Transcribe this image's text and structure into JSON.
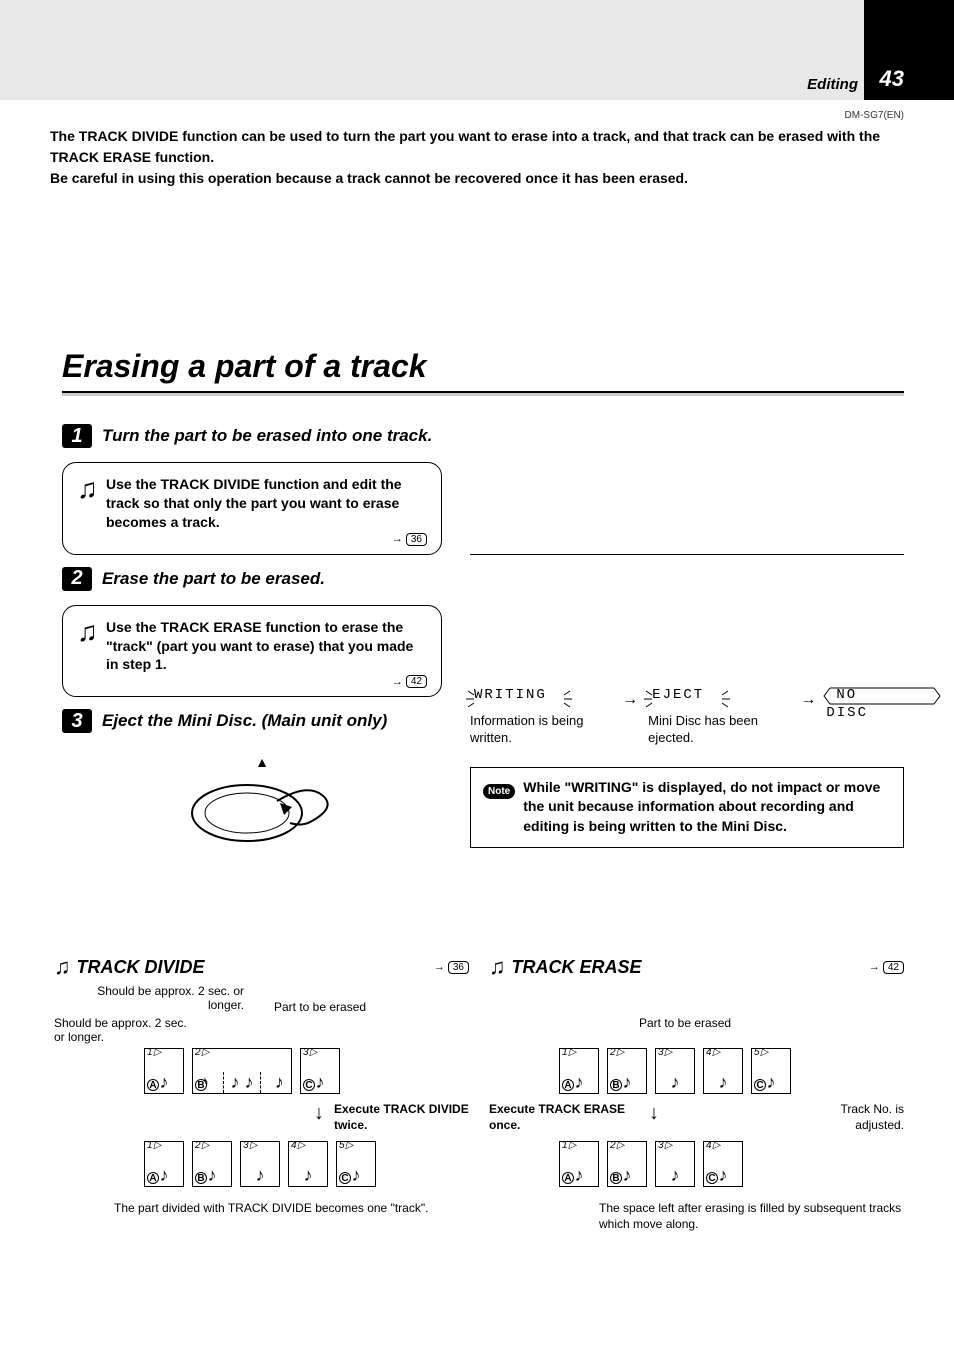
{
  "header": {
    "section": "Editing",
    "page": "43",
    "model": "DM-SG7(EN)"
  },
  "intro": "The TRACK DIVIDE function can be used to turn the part you want to erase into a track, and that track can be erased with the TRACK ERASE function.\nBe careful in using this operation because a track cannot be recovered once it has been erased.",
  "title": "Erasing a part of a track",
  "steps": [
    {
      "num": "1",
      "title": "Turn the part to be erased into one track.",
      "body": "Use the TRACK DIVIDE function and edit the track so that only the part you want to erase becomes a track.",
      "ref": "36"
    },
    {
      "num": "2",
      "title": "Erase the part to be erased.",
      "body": "Use the TRACK ERASE function to erase the \"track\" (part you want to erase) that you made in step 1.",
      "ref": "42"
    },
    {
      "num": "3",
      "title": "Eject the Mini Disc. (Main unit only)"
    }
  ],
  "displays": {
    "writing": {
      "text": "WRITING",
      "caption": "Information is being written."
    },
    "eject": {
      "text": "EJECT",
      "caption": "Mini Disc has been ejected."
    },
    "nodisc": {
      "text": "NO DISC"
    }
  },
  "note": "While \"WRITING\" is displayed, do not impact or move the unit because information about recording and editing is being written to the Mini Disc.",
  "note_label": "Note",
  "diagrams": {
    "divide": {
      "title": "TRACK DIVIDE",
      "ref": "36",
      "label_approx_top": "Should be approx. 2 sec. or longer.",
      "label_approx_left": "Should be approx. 2 sec. or longer.",
      "label_part": "Part to be erased",
      "action": "Execute TRACK DIVIDE twice.",
      "caption": "The part divided with TRACK DIVIDE becomes one \"track\".",
      "before": [
        {
          "n": "1",
          "l": "A"
        },
        {
          "n": "2",
          "l": "B",
          "wide": true
        },
        {
          "n": "3",
          "l": "C"
        }
      ],
      "after": [
        {
          "n": "1",
          "l": "A"
        },
        {
          "n": "2",
          "l": "B"
        },
        {
          "n": "3",
          "l": ""
        },
        {
          "n": "4",
          "l": ""
        },
        {
          "n": "5",
          "l": "C"
        }
      ]
    },
    "erase": {
      "title": "TRACK ERASE",
      "ref": "42",
      "label_part": "Part to be erased",
      "action": "Execute TRACK ERASE once.",
      "label_adjust": "Track No. is adjusted.",
      "caption": "The space left after erasing is filled by subsequent tracks which move along.",
      "before": [
        {
          "n": "1",
          "l": "A"
        },
        {
          "n": "2",
          "l": "B"
        },
        {
          "n": "3",
          "l": ""
        },
        {
          "n": "4",
          "l": ""
        },
        {
          "n": "5",
          "l": "C"
        }
      ],
      "after": [
        {
          "n": "1",
          "l": "A"
        },
        {
          "n": "2",
          "l": "B"
        },
        {
          "n": "3",
          "l": ""
        },
        {
          "n": "4",
          "l": "C"
        }
      ]
    }
  }
}
